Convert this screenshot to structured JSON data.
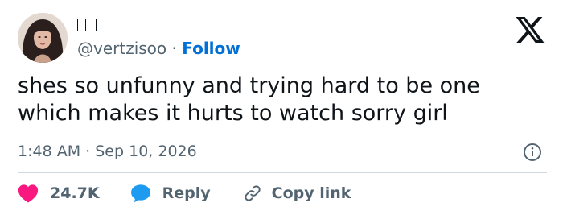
{
  "tweet": {
    "author": {
      "display_name": "",
      "handle": "@vertzisoo",
      "separator": "·",
      "follow_label": "Follow",
      "avatar_icon": "profile-photo"
    },
    "text": "shes so unfunny and trying hard to be one which makes it hurts to watch sorry girl",
    "time": "1:48 AM",
    "date_separator": "·",
    "date": "Sep 10, 2026",
    "platform_icon": "x-logo-icon",
    "info_icon": "info-icon"
  },
  "actions": {
    "likes_count": "24.7K",
    "reply_label": "Reply",
    "copy_link_label": "Copy link"
  },
  "colors": {
    "text": "#0f1419",
    "muted": "#536471",
    "follow": "#006fd6",
    "heart": "#f91880",
    "reply_bubble": "#1d9bf0",
    "divider": "#cfd9de"
  }
}
